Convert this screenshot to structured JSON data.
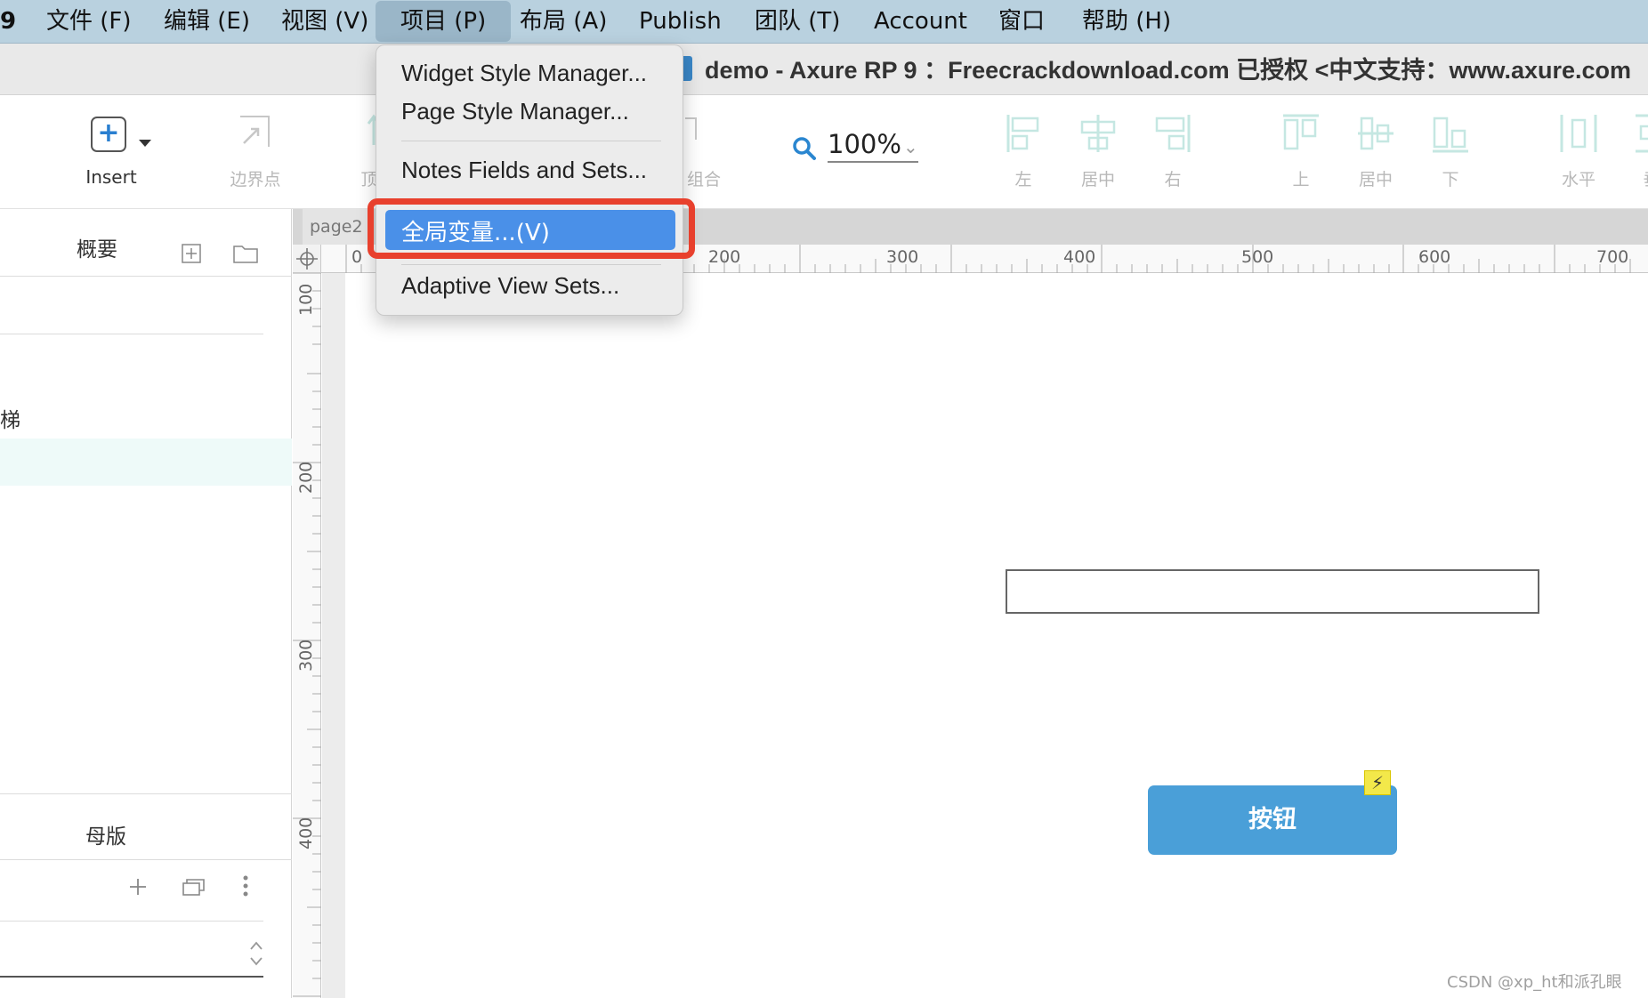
{
  "menubar": {
    "app_fragment": "9",
    "items": [
      {
        "label": "文件 (F)"
      },
      {
        "label": "编辑 (E)"
      },
      {
        "label": "视图 (V)"
      },
      {
        "label": "项目 (P)"
      },
      {
        "label": "布局 (A)"
      },
      {
        "label": "Publish"
      },
      {
        "label": "团队 (T)"
      },
      {
        "label": "Account"
      },
      {
        "label": "窗口"
      },
      {
        "label": "帮助 (H)"
      }
    ]
  },
  "titlebar": {
    "title": "demo - Axure RP 9 ：Freecrackdownload.com 已授权    <中文支持：www.axure.com"
  },
  "toolbar": {
    "insert_label": "Insert",
    "boundary_label": "边界点",
    "top_partial_label": "顶",
    "group_label": "组合",
    "zoom_value": "100%",
    "align": [
      {
        "label": "左"
      },
      {
        "label": "居中"
      },
      {
        "label": "右"
      },
      {
        "label": "上"
      },
      {
        "label": "居中"
      },
      {
        "label": "下"
      },
      {
        "label": "水平"
      },
      {
        "label": "垂"
      }
    ]
  },
  "left_panel": {
    "outline_title": "概要",
    "outline_partial_item": "梯",
    "masters_title": "母版"
  },
  "canvas": {
    "tab_label": "page2",
    "ruler_h": [
      "0",
      "200",
      "300",
      "400",
      "500",
      "600",
      "700"
    ],
    "ruler_v": [
      "100",
      "200",
      "300",
      "400"
    ],
    "button_label": "按钮"
  },
  "dropdown": {
    "items": [
      {
        "label": "Widget Style Manager..."
      },
      {
        "label": "Page Style Manager..."
      },
      {
        "label": "Notes Fields and Sets..."
      },
      {
        "label": "全局变量...(V)"
      },
      {
        "label": "Adaptive View Sets..."
      }
    ]
  },
  "watermark": "CSDN @xp_ht和派孔眼",
  "colors": {
    "menubar_bg": "#b9d1df",
    "highlight_blue": "#4a90e8",
    "highlight_frame": "#e8402d",
    "button_blue": "#4a9fd8"
  }
}
